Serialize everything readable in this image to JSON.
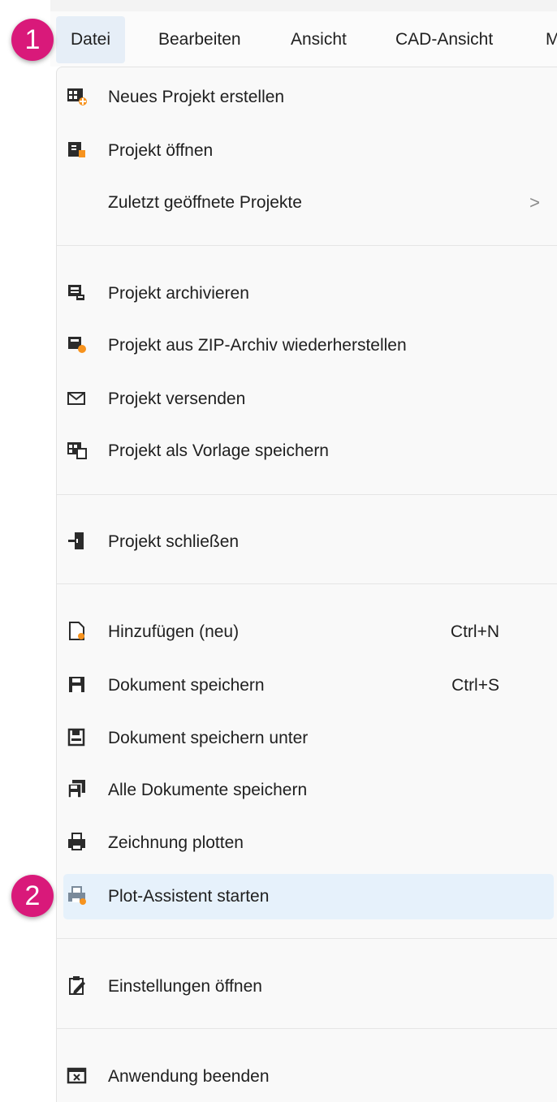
{
  "menubar": {
    "tabs": [
      {
        "label": "Datei"
      },
      {
        "label": "Bearbeiten"
      },
      {
        "label": "Ansicht"
      },
      {
        "label": "CAD-Ansicht"
      },
      {
        "label": "M"
      }
    ]
  },
  "menu": {
    "items": [
      {
        "label": "Neues Projekt erstellen",
        "icon": "new-project-icon"
      },
      {
        "label": "Projekt öffnen",
        "icon": "open-project-icon"
      },
      {
        "label": "Zuletzt geöffnete Projekte",
        "submenu_indicator": ">"
      },
      {
        "label": "Projekt archivieren",
        "icon": "archive-project-icon"
      },
      {
        "label": "Projekt aus ZIP-Archiv wiederherstellen",
        "icon": "restore-zip-icon"
      },
      {
        "label": "Projekt versenden",
        "icon": "envelope-icon"
      },
      {
        "label": "Projekt als Vorlage speichern",
        "icon": "save-template-icon"
      },
      {
        "label": "Projekt schließen",
        "icon": "close-project-icon"
      },
      {
        "label": "Hinzufügen (neu)",
        "icon": "new-document-icon",
        "shortcut": "Ctrl+N"
      },
      {
        "label": "Dokument speichern",
        "icon": "save-icon",
        "shortcut": "Ctrl+S"
      },
      {
        "label": "Dokument speichern unter",
        "icon": "save-as-icon"
      },
      {
        "label": "Alle Dokumente speichern",
        "icon": "save-all-icon"
      },
      {
        "label": "Zeichnung plotten",
        "icon": "printer-icon"
      },
      {
        "label": "Plot-Assistent starten",
        "icon": "plot-wizard-icon",
        "highlighted": true
      },
      {
        "label": "Einstellungen öffnen",
        "icon": "settings-icon"
      },
      {
        "label": "Anwendung beenden",
        "icon": "exit-app-icon"
      }
    ]
  },
  "annotations": {
    "badge1": "1",
    "badge2": "2",
    "badge_color": "#d9197a"
  },
  "colors": {
    "accent_orange": "#f7931e",
    "icon_dark": "#2b2b2b",
    "highlight_bg": "#e6f1fb"
  }
}
